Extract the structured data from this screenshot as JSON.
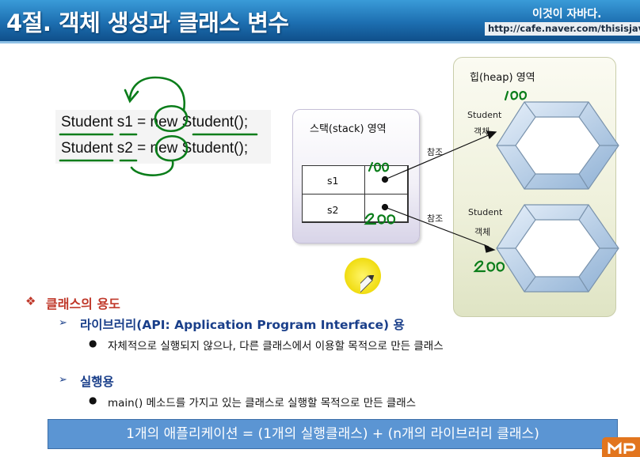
{
  "header": {
    "title": "4절. 객체 생성과 클래스 변수",
    "brand_name": "이것이 자바다.",
    "brand_url": "http://cafe.naver.com/thisisjava"
  },
  "code": {
    "line1": {
      "type": "Student",
      "var": "s1",
      "eq": "=",
      "kw": "new",
      "ctor": "Student();"
    },
    "line2": {
      "type": "Student",
      "var": "s2",
      "eq": "=",
      "kw": "new",
      "ctor": "Student();"
    }
  },
  "stack": {
    "title": "스택(stack) 영역",
    "rows": [
      {
        "name": "s1",
        "ref_note": "100"
      },
      {
        "name": "s2",
        "ref_note": "200"
      }
    ]
  },
  "references": [
    "참조",
    "참조"
  ],
  "heap": {
    "title": "힙(heap) 영역",
    "objects": [
      {
        "line1": "Student",
        "line2": "객체",
        "address_note": "100"
      },
      {
        "line1": "Student",
        "line2": "객체",
        "address_note": "200"
      }
    ]
  },
  "uses": {
    "heading": "클래스의 용도",
    "items": [
      {
        "title": "라이브러리(API: Application Program Interface) 용",
        "bullet": "자체적으로 실행되지 않으나, 다른 클래스에서 이용할 목적으로 만든 클래스"
      },
      {
        "title": "실행용",
        "bullet": "main() 메소드를 가지고 있는 클래스로 실행할 목적으로 만든 클래스"
      }
    ]
  },
  "formula": "1개의 애플리케이션 = (1개의 실행클래스) + (n개의 라이브러리 클래스)",
  "colors": {
    "header_blue": "#1d6fb1",
    "formula_blue": "#5b95d3",
    "heading_red": "#c0392b",
    "annotation_green": "#0a7d1a",
    "cursor_yellow": "#f4e21a",
    "hexagon_blue": "#b8cfe6"
  }
}
